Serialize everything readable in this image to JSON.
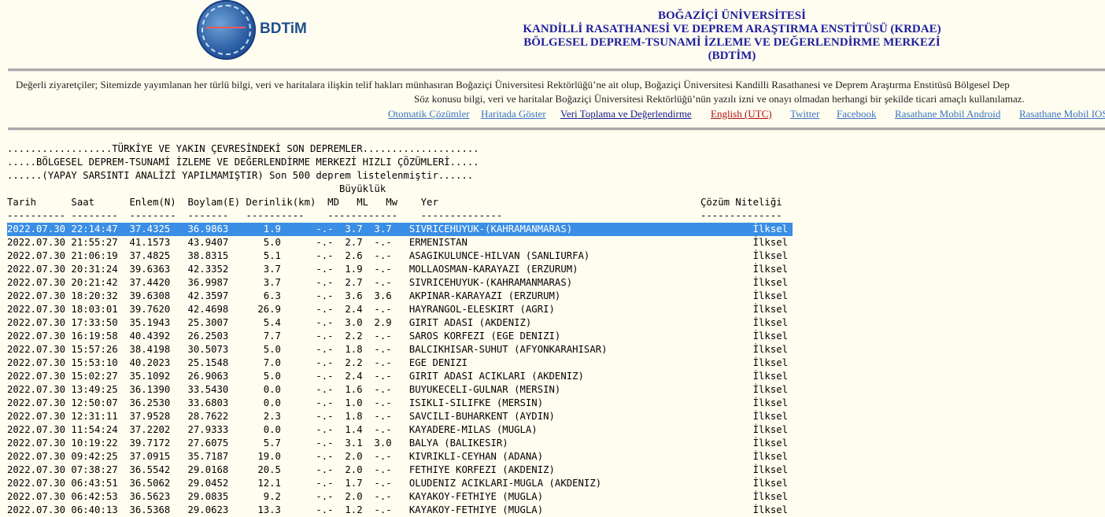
{
  "header": {
    "logo_text": "BDTiM",
    "title_1": "BOĞAZİÇİ ÜNİVERSİTESİ",
    "title_2": "KANDİLLİ RASATHANESİ VE DEPREM ARAŞTIRMA ENSTİTÜSÜ (KRDAE)",
    "title_3": "BÖLGESEL DEPREM-TSUNAMİ İZLEME VE DEĞERLENDİRME MERKEZİ (BDTİM)"
  },
  "notice": {
    "line_1": "Değerli ziyaretçiler; Sitemizde yayımlanan her türlü bilgi, veri ve haritalara ilişkin telif hakları münhasıran Boğaziçi Üniversitesi Rektörlüğü’ne ait olup, Boğaziçi Üniversitesi Kandilli Rasathanesi ve Deprem Araştırma Enstitüsü Bölgesel Dep",
    "line_2": "Söz konusu bilgi, veri ve haritalar Boğaziçi Üniversitesi Rektörlüğü’nün yazılı izni ve onayı olmadan herhangi bir şekilde ticari amaçlı kullanılamaz."
  },
  "links": [
    {
      "label": "Otomatik Çözümler",
      "color": "#3a74c4"
    },
    {
      "label": "Haritada Göster",
      "color": "#3a74c4"
    },
    {
      "label": "Veri Toplama ve Değerlendirme",
      "color": "#1a1a8c"
    },
    {
      "label": "English (UTC)",
      "color": "#b01010"
    },
    {
      "label": "Twitter",
      "color": "#3a74c4"
    },
    {
      "label": "Facebook",
      "color": "#3a74c4"
    },
    {
      "label": "Rasathane Mobil Android",
      "color": "#3a74c4"
    },
    {
      "label": "Rasathane Mobil IOS",
      "color": "#3a74c4"
    }
  ],
  "listing": {
    "title_lines": [
      "..................TÜRKİYE VE YAKIN ÇEVRESİNDEKİ SON DEPREMLER....................",
      ".....BÖLGESEL DEPREM-TSUNAMİ İZLEME VE DEĞERLENDİRME MERKEZİ HIZLI ÇÖZÜMLERİ.....",
      "......(YAPAY SARSINTI ANALİZİ YAPILMAMIŞTIR) Son 500 deprem listelenmiştir......"
    ],
    "header_lines": [
      "                                                         Büyüklük",
      "Tarih      Saat      Enlem(N)  Boylam(E) Derinlik(km)  MD   ML   Mw    Yer                                             Çözüm Niteliği",
      "---------- --------  --------  -------   ----------    ------------    --------------                                  --------------"
    ],
    "rows": [
      [
        "2022.07.30",
        "22:14:47",
        "37.4325",
        "36.9863",
        "1.9",
        "-.-",
        "3.7",
        "3.7",
        "SIVRICEHUYUK-(KAHRAMANMARAS)",
        "İlksel"
      ],
      [
        "2022.07.30",
        "21:55:27",
        "41.1573",
        "43.9407",
        "5.0",
        "-.-",
        "2.7",
        "-.-",
        "ERMENISTAN",
        "İlksel"
      ],
      [
        "2022.07.30",
        "21:06:19",
        "37.4825",
        "38.8315",
        "5.1",
        "-.-",
        "2.6",
        "-.-",
        "ASAGIKULUNCE-HILVAN (SANLIURFA)",
        "İlksel"
      ],
      [
        "2022.07.30",
        "20:31:24",
        "39.6363",
        "42.3352",
        "3.7",
        "-.-",
        "1.9",
        "-.-",
        "MOLLAOSMAN-KARAYAZI (ERZURUM)",
        "İlksel"
      ],
      [
        "2022.07.30",
        "20:21:42",
        "37.4420",
        "36.9987",
        "3.7",
        "-.-",
        "2.7",
        "-.-",
        "SIVRICEHUYUK-(KAHRAMANMARAS)",
        "İlksel"
      ],
      [
        "2022.07.30",
        "18:20:32",
        "39.6308",
        "42.3597",
        "6.3",
        "-.-",
        "3.6",
        "3.6",
        "AKPINAR-KARAYAZI (ERZURUM)",
        "İlksel"
      ],
      [
        "2022.07.30",
        "18:03:01",
        "39.7620",
        "42.4698",
        "26.9",
        "-.-",
        "2.4",
        "-.-",
        "HAYRANGOL-ELESKIRT (AGRI)",
        "İlksel"
      ],
      [
        "2022.07.30",
        "17:33:50",
        "35.1943",
        "25.3007",
        "5.4",
        "-.-",
        "3.0",
        "2.9",
        "GIRIT ADASI (AKDENIZ)",
        "İlksel"
      ],
      [
        "2022.07.30",
        "16:19:58",
        "40.4392",
        "26.2503",
        "7.7",
        "-.-",
        "2.2",
        "-.-",
        "SAROS KORFEZI (EGE DENIZI)",
        "İlksel"
      ],
      [
        "2022.07.30",
        "15:57:26",
        "38.4198",
        "30.5073",
        "5.0",
        "-.-",
        "1.8",
        "-.-",
        "BALCIKHISAR-SUHUT (AFYONKARAHISAR)",
        "İlksel"
      ],
      [
        "2022.07.30",
        "15:53:10",
        "40.2023",
        "25.1548",
        "7.0",
        "-.-",
        "2.2",
        "-.-",
        "EGE DENIZI",
        "İlksel"
      ],
      [
        "2022.07.30",
        "15:02:27",
        "35.1092",
        "26.9063",
        "5.0",
        "-.-",
        "2.4",
        "-.-",
        "GIRIT ADASI ACIKLARI (AKDENIZ)",
        "İlksel"
      ],
      [
        "2022.07.30",
        "13:49:25",
        "36.1390",
        "33.5430",
        "0.0",
        "-.-",
        "1.6",
        "-.-",
        "BUYUKECELI-GULNAR (MERSIN)",
        "İlksel"
      ],
      [
        "2022.07.30",
        "12:50:07",
        "36.2530",
        "33.6803",
        "0.0",
        "-.-",
        "1.0",
        "-.-",
        "ISIKLI-SILIFKE (MERSIN)",
        "İlksel"
      ],
      [
        "2022.07.30",
        "12:31:11",
        "37.9528",
        "28.7622",
        "2.3",
        "-.-",
        "1.8",
        "-.-",
        "SAVCILI-BUHARKENT (AYDIN)",
        "İlksel"
      ],
      [
        "2022.07.30",
        "11:54:24",
        "37.2202",
        "27.9333",
        "0.0",
        "-.-",
        "1.4",
        "-.-",
        "KAYADERE-MILAS (MUGLA)",
        "İlksel"
      ],
      [
        "2022.07.30",
        "10:19:22",
        "39.7172",
        "27.6075",
        "5.7",
        "-.-",
        "3.1",
        "3.0",
        "BALYA (BALIKESIR)",
        "İlksel"
      ],
      [
        "2022.07.30",
        "09:42:25",
        "37.0915",
        "35.7187",
        "19.0",
        "-.-",
        "2.0",
        "-.-",
        "KIVRIKLI-CEYHAN (ADANA)",
        "İlksel"
      ],
      [
        "2022.07.30",
        "07:38:27",
        "36.5542",
        "29.0168",
        "20.5",
        "-.-",
        "2.0",
        "-.-",
        "FETHIYE KORFEZI (AKDENIZ)",
        "İlksel"
      ],
      [
        "2022.07.30",
        "06:43:51",
        "36.5062",
        "29.0452",
        "12.1",
        "-.-",
        "1.7",
        "-.-",
        "OLUDENIZ ACIKLARI-MUGLA (AKDENIZ)",
        "İlksel"
      ],
      [
        "2022.07.30",
        "06:42:53",
        "36.5623",
        "29.0835",
        "9.2",
        "-.-",
        "2.0",
        "-.-",
        "KAYAKOY-FETHIYE (MUGLA)",
        "İlksel"
      ],
      [
        "2022.07.30",
        "06:40:13",
        "36.5368",
        "29.0623",
        "13.3",
        "-.-",
        "1.2",
        "-.-",
        "KAYAKOY-FETHIYE (MUGLA)",
        "İlksel"
      ]
    ]
  }
}
